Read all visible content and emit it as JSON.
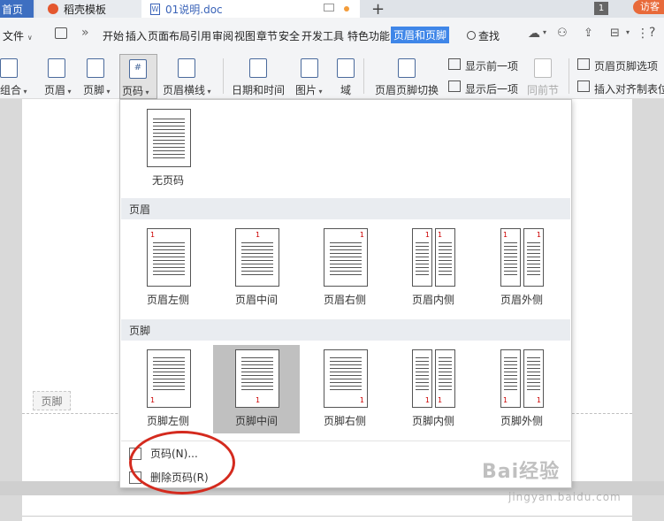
{
  "tabs": {
    "home": "首页",
    "daoke": "稻壳模板",
    "doc": "01说明.doc",
    "new_tab": "+",
    "badge": "1",
    "visitor": "访客"
  },
  "menubar": {
    "file": "文件",
    "items": [
      "开始",
      "插入",
      "页面布局",
      "引用",
      "审阅",
      "视图",
      "章节",
      "安全",
      "开发工具",
      "特色功能",
      "页眉和页脚"
    ],
    "search": "查找",
    "help": "?"
  },
  "ribbon": {
    "combo": "组合",
    "header": "页眉",
    "footer": "页脚",
    "page_number": "页码",
    "header_line": "页眉横线",
    "date_time": "日期和时间",
    "picture": "图片",
    "field": "域",
    "switch": "页眉页脚切换",
    "show_prev": "显示前一项",
    "show_next": "显示后一项",
    "same_as_prev": "同前节",
    "options": "页眉页脚选项",
    "insert_align_tab": "插入对齐制表位"
  },
  "dropdown": {
    "no_number": "无页码",
    "header_section": "页眉",
    "footer_section": "页脚",
    "header_options": [
      "页眉左侧",
      "页眉中间",
      "页眉右侧",
      "页眉内侧",
      "页眉外侧"
    ],
    "footer_options": [
      "页脚左侧",
      "页脚中间",
      "页脚右侧",
      "页脚内侧",
      "页脚外侧"
    ],
    "page_number_item": "页码(N)...",
    "delete_item": "删除页码(R)",
    "sample_number": "1"
  },
  "document": {
    "footer_tag": "页脚"
  },
  "watermark": {
    "brand": "Bai经验",
    "url": "jingyan.baidu.com"
  },
  "colors": {
    "accent": "#3f86e8",
    "highlight_circle": "#d42a1e",
    "selected_option": "#c0c0c0"
  }
}
